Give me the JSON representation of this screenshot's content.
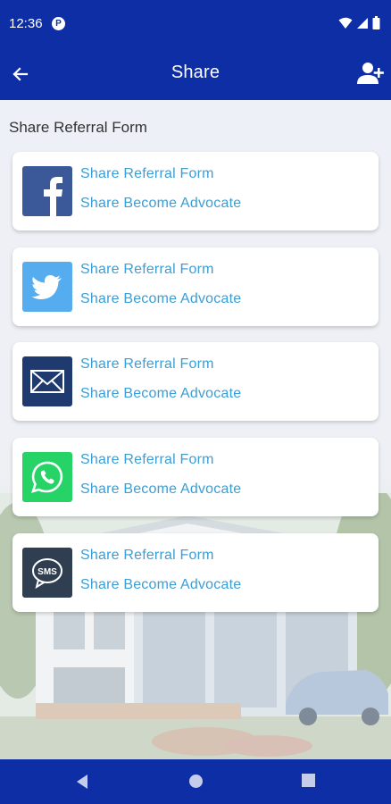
{
  "status_bar": {
    "time": "12:36",
    "notification_icon": "p-circle-icon"
  },
  "app_bar": {
    "title": "Share",
    "back_icon": "arrow-left-icon",
    "action_icon": "add-user-icon"
  },
  "section": {
    "title": "Share Referral Form"
  },
  "cards": [
    {
      "platform": "facebook",
      "link1": "Share Referral Form",
      "link2": "Share Become Advocate",
      "color": "#3b5998"
    },
    {
      "platform": "twitter",
      "link1": "Share Referral Form",
      "link2": "Share Become Advocate",
      "color": "#55acee"
    },
    {
      "platform": "email",
      "link1": "Share Referral Form",
      "link2": "Share Become Advocate",
      "color": "#1f3a6e"
    },
    {
      "platform": "whatsapp",
      "link1": "Share Referral Form",
      "link2": "Share Become Advocate",
      "color": "#25d366"
    },
    {
      "platform": "sms",
      "link1": "Share Referral Form",
      "link2": "Share Become Advocate",
      "color": "#2f3e50"
    }
  ],
  "colors": {
    "primary": "#0d2ea5",
    "link": "#3a9ed7"
  }
}
